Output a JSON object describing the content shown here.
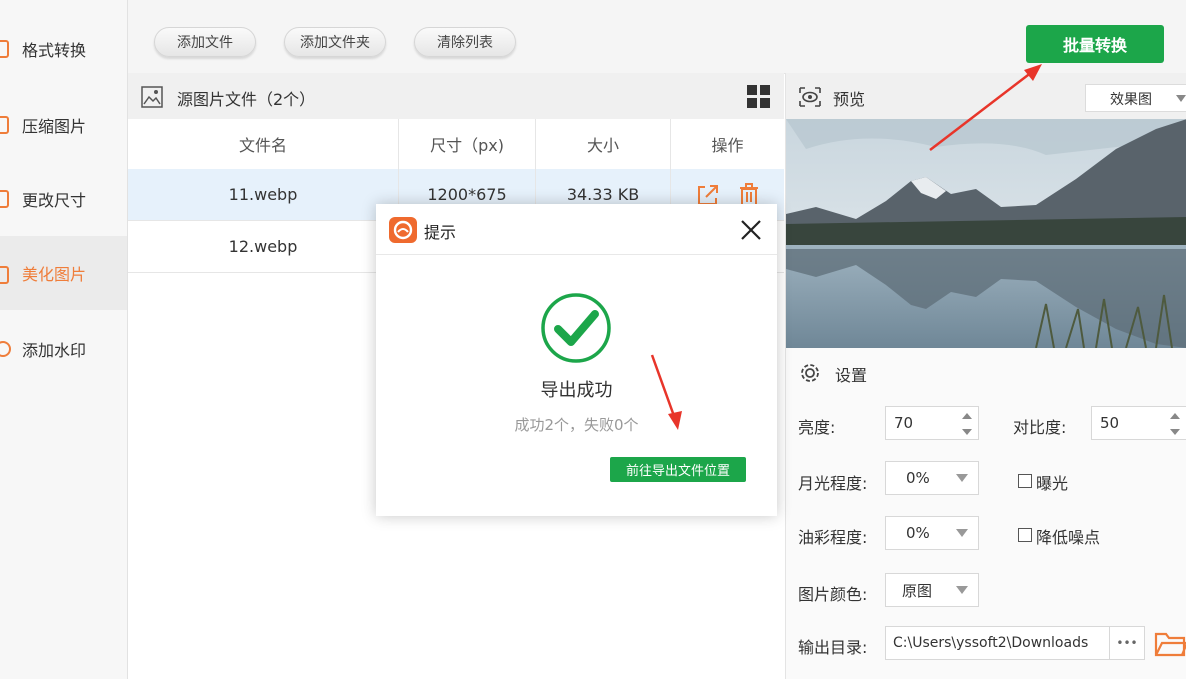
{
  "sidebar": {
    "items": [
      {
        "label": "格式转换"
      },
      {
        "label": "压缩图片"
      },
      {
        "label": "更改尺寸"
      },
      {
        "label": "美化图片"
      },
      {
        "label": "添加水印"
      }
    ]
  },
  "toolbar": {
    "add_file": "添加文件",
    "add_folder": "添加文件夹",
    "clear_list": "清除列表",
    "batch_convert": "批量转换"
  },
  "file_panel": {
    "title": "源图片文件（2个）",
    "columns": [
      "文件名",
      "尺寸（px)",
      "大小",
      "操作"
    ],
    "rows": [
      {
        "name": "11.webp",
        "size_px": "1200*675",
        "filesize": "34.33 KB"
      },
      {
        "name": "12.webp",
        "size_px": "",
        "filesize": ""
      }
    ]
  },
  "preview": {
    "title": "预览",
    "mode": "效果图"
  },
  "settings": {
    "title": "设置",
    "brightness_label": "亮度:",
    "brightness_value": "70",
    "contrast_label": "对比度:",
    "contrast_value": "50",
    "moonlight_label": "月光程度:",
    "moonlight_value": "0%",
    "exposure_label": "曝光",
    "oil_label": "油彩程度:",
    "oil_value": "0%",
    "denoise_label": "降低噪点",
    "color_label": "图片颜色:",
    "color_value": "原图",
    "output_label": "输出目录:",
    "output_value": "C:\\Users\\yssoft2\\Downloads",
    "more": "•••"
  },
  "dialog": {
    "title": "提示",
    "message": "导出成功",
    "detail": "成功2个，失败0个",
    "open_location": "前往导出文件位置"
  },
  "colors": {
    "accent_green": "#1ca64a",
    "accent_orange": "#ef7d3a",
    "arrow_red": "#e8352a"
  }
}
